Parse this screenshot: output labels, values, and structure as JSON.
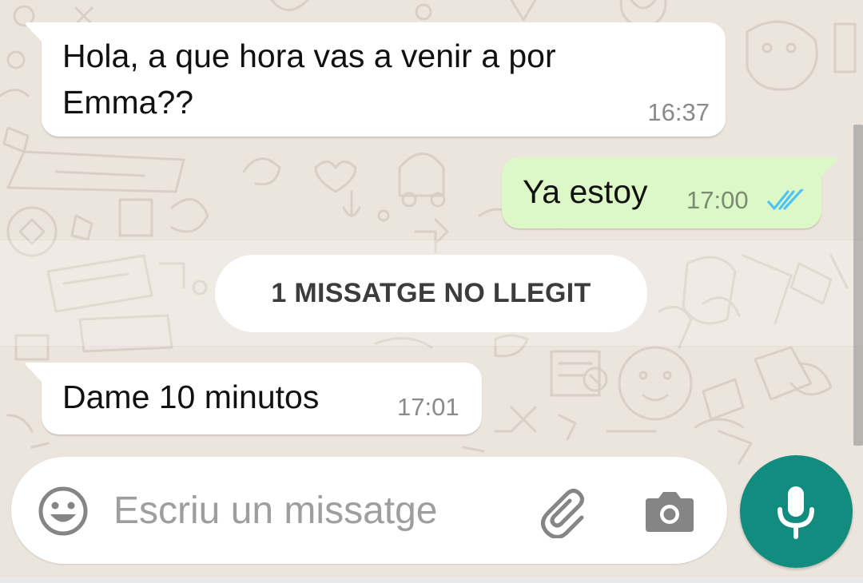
{
  "theme": {
    "chat_background": "#ece5dd",
    "incoming_bubble": "#ffffff",
    "outgoing_bubble": "#dcf8c6",
    "read_ticks": "#4fc3f7",
    "accent": "#128c7e"
  },
  "messages": [
    {
      "direction": "incoming",
      "text": "Hola, a que hora vas a venir a por\nEmma??",
      "time": "16:37"
    },
    {
      "direction": "outgoing",
      "text": "Ya estoy",
      "time": "17:00",
      "status_icon": "double-check-read-icon"
    },
    {
      "direction": "incoming",
      "text": "Dame 10 minutos",
      "time": "17:01"
    }
  ],
  "unread_banner": {
    "label": "1 MISSATGE NO LLEGIT"
  },
  "composer": {
    "placeholder": "Escriu un missatge",
    "value": "",
    "icons": [
      "smiley-icon",
      "paperclip-icon",
      "camera-icon",
      "microphone-icon"
    ]
  }
}
